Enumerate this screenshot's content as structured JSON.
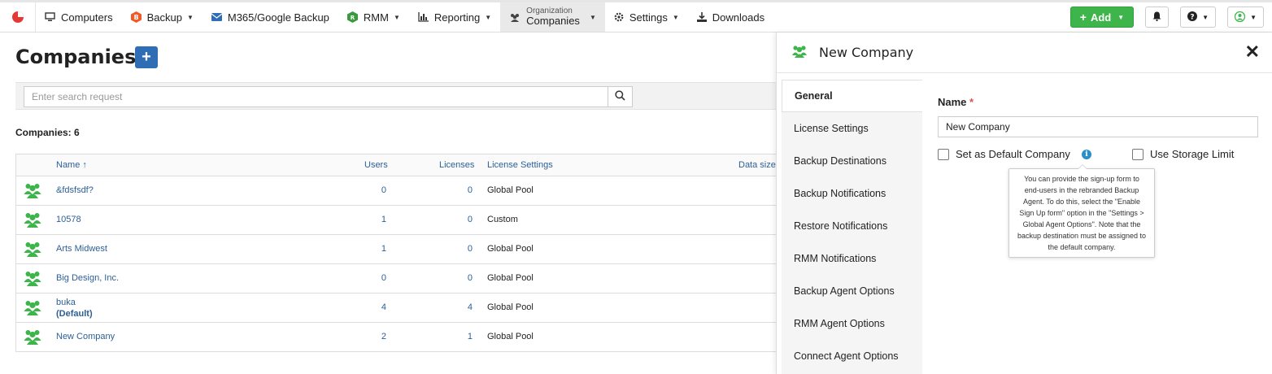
{
  "nav": {
    "items": [
      {
        "label": "Computers",
        "icon": "monitor-icon",
        "caret": false
      },
      {
        "label": "Backup",
        "icon": "backup-icon",
        "caret": true
      },
      {
        "label": "M365/Google Backup",
        "icon": "envelope-icon",
        "caret": false
      },
      {
        "label": "RMM",
        "icon": "rmm-icon",
        "caret": true
      },
      {
        "label": "Reporting",
        "icon": "bar-chart-icon",
        "caret": true
      }
    ],
    "active": {
      "small": "Organization",
      "label": "Companies"
    },
    "settings": "Settings",
    "downloads": "Downloads",
    "add_label": "Add"
  },
  "page": {
    "title": "Companies",
    "search_placeholder": "Enter search request",
    "count": "Companies: 6"
  },
  "table": {
    "headers": {
      "name": "Name ↑",
      "users": "Users",
      "licenses": "Licenses",
      "license_settings": "License Settings",
      "data_size": "Data size"
    },
    "rows": [
      {
        "name": "&fdsfsdf?",
        "sub": "",
        "users": "0",
        "licenses": "0",
        "settings": "Global Pool"
      },
      {
        "name": "10578",
        "sub": "",
        "users": "1",
        "licenses": "0",
        "settings": "Custom"
      },
      {
        "name": "Arts Midwest",
        "sub": "",
        "users": "1",
        "licenses": "0",
        "settings": "Global Pool"
      },
      {
        "name": "Big Design, Inc.",
        "sub": "",
        "users": "0",
        "licenses": "0",
        "settings": "Global Pool"
      },
      {
        "name": "buka",
        "sub": "(Default)",
        "users": "4",
        "licenses": "4",
        "settings": "Global Pool"
      },
      {
        "name": "New Company",
        "sub": "",
        "users": "2",
        "licenses": "1",
        "settings": "Global Pool"
      }
    ]
  },
  "panel": {
    "title": "New Company",
    "tabs": [
      "General",
      "License Settings",
      "Backup Destinations",
      "Backup Notifications",
      "Restore Notifications",
      "RMM Notifications",
      "Backup Agent Options",
      "RMM Agent Options",
      "Connect Agent Options"
    ],
    "name_label": "Name",
    "name_required": "*",
    "name_value": "New Company",
    "default_label": "Set as Default Company",
    "storage_label": "Use Storage Limit",
    "tooltip": "You can provide the sign-up form to end-users in the rebranded Backup Agent. To do this, select the \"Enable Sign Up form\" option in the \"Settings > Global Agent Options\". Note that the backup destination must be assigned to the default company."
  },
  "colors": {
    "accent_green": "#3db54a",
    "link_blue": "#2b5f98",
    "primary_blue": "#2f6db5"
  }
}
